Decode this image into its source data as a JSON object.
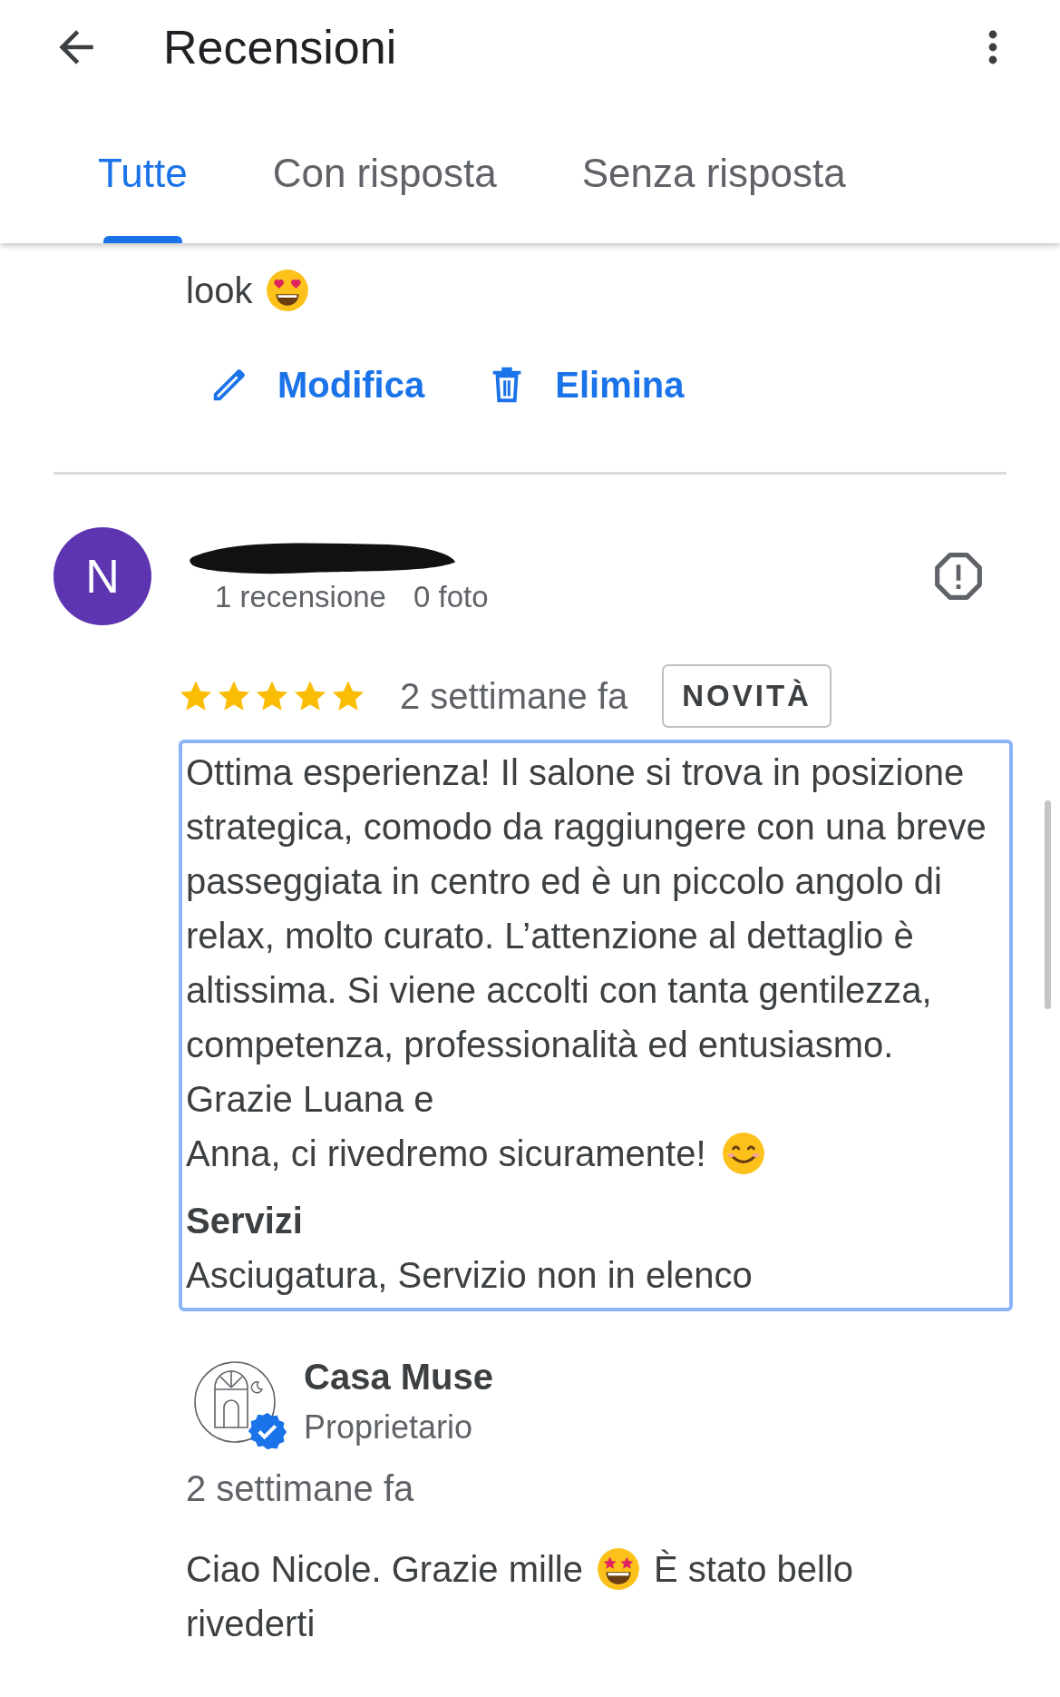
{
  "header": {
    "title": "Recensioni"
  },
  "tabs": [
    {
      "label": "Tutte",
      "selected": true
    },
    {
      "label": "Con risposta",
      "selected": false
    },
    {
      "label": "Senza risposta",
      "selected": false
    }
  ],
  "previous_review": {
    "text_segments": [
      {
        "kind": "text",
        "text": "look"
      },
      {
        "kind": "hearteyes"
      }
    ],
    "actions": [
      {
        "kind": "edit",
        "label": "Modifica"
      },
      {
        "kind": "delete",
        "label": "Elimina"
      }
    ]
  },
  "review": {
    "avatar_letter": "N",
    "author_redacted": true,
    "meta": [
      "1 recensione",
      "0 foto"
    ],
    "stars": 5,
    "time": "2 settimane fa",
    "badge": "NOVITÀ",
    "focused": true,
    "text_segments": [
      {
        "kind": "text",
        "text": "Ottima esperienza! Il salone si trova in posizione strategica, comodo da raggiungere con una breve passeggiata in centro ed è un piccolo angolo di relax, molto curato. L’attenzione al dettaglio è altissima. Si viene accolti con tanta gentilezza, competenza, professionalità ed entusiasmo. Grazie Luana e"
      },
      {
        "kind": "text",
        "text": "Anna, ci rivedremo sicuramente!"
      },
      {
        "kind": "smiley"
      }
    ],
    "services_label": "Servizi",
    "services": "Asciugatura, Servizio non in elenco"
  },
  "owner_reply": {
    "name": "Casa Muse",
    "verified": true,
    "role": "Proprietario",
    "time": "2 settimane fa",
    "text_segments": [
      {
        "kind": "text",
        "text": "Ciao Nicole. Grazie mille"
      },
      {
        "kind": "starstruck"
      },
      {
        "kind": "text",
        "text": "È stato bello"
      },
      {
        "kind": "text",
        "text": "rivederti"
      }
    ]
  }
}
